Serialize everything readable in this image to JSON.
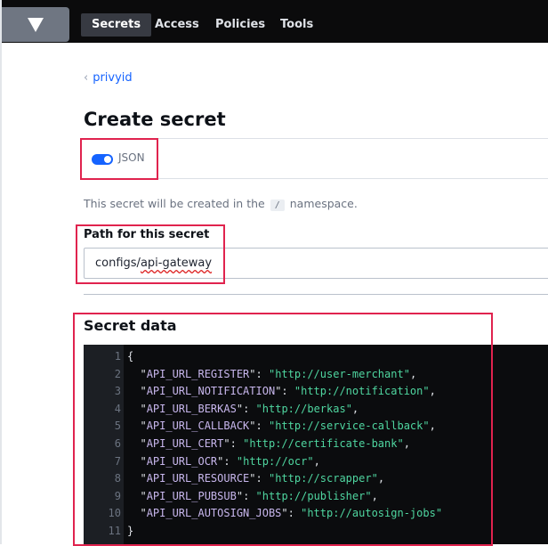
{
  "nav": {
    "tabs": [
      "Secrets",
      "Access",
      "Policies",
      "Tools"
    ],
    "active": "Secrets"
  },
  "breadcrumb": {
    "label": "privyid"
  },
  "page": {
    "title": "Create secret"
  },
  "toolbar": {
    "json_toggle_label": "JSON",
    "json_toggle_on": true
  },
  "namespace": {
    "prefix": "This secret will be created in the",
    "value": "/",
    "suffix": "namespace."
  },
  "path": {
    "label": "Path for this secret",
    "value_prefix": "configs/",
    "value_misspelled": "api-gateway"
  },
  "secret_data": {
    "label": "Secret data",
    "entries": [
      {
        "key": "API_URL_REGISTER",
        "value": "http://user-merchant"
      },
      {
        "key": "API_URL_NOTIFICATION",
        "value": "http://notification"
      },
      {
        "key": "API_URL_BERKAS",
        "value": "http://berkas"
      },
      {
        "key": "API_URL_CALLBACK",
        "value": "http://service-callback"
      },
      {
        "key": "API_URL_CERT",
        "value": "http://certificate-bank"
      },
      {
        "key": "API_URL_OCR",
        "value": "http://ocr"
      },
      {
        "key": "API_URL_RESOURCE",
        "value": "http://scrapper"
      },
      {
        "key": "API_URL_PUBSUB",
        "value": "http://publisher"
      },
      {
        "key": "API_URL_AUTOSIGN_JOBS",
        "value": "http://autosign-jobs"
      }
    ]
  },
  "colors": {
    "accent": "#1563ff",
    "highlight": "#e0234e",
    "json_key": "#c7b6ec",
    "json_value": "#4fd6a0"
  }
}
